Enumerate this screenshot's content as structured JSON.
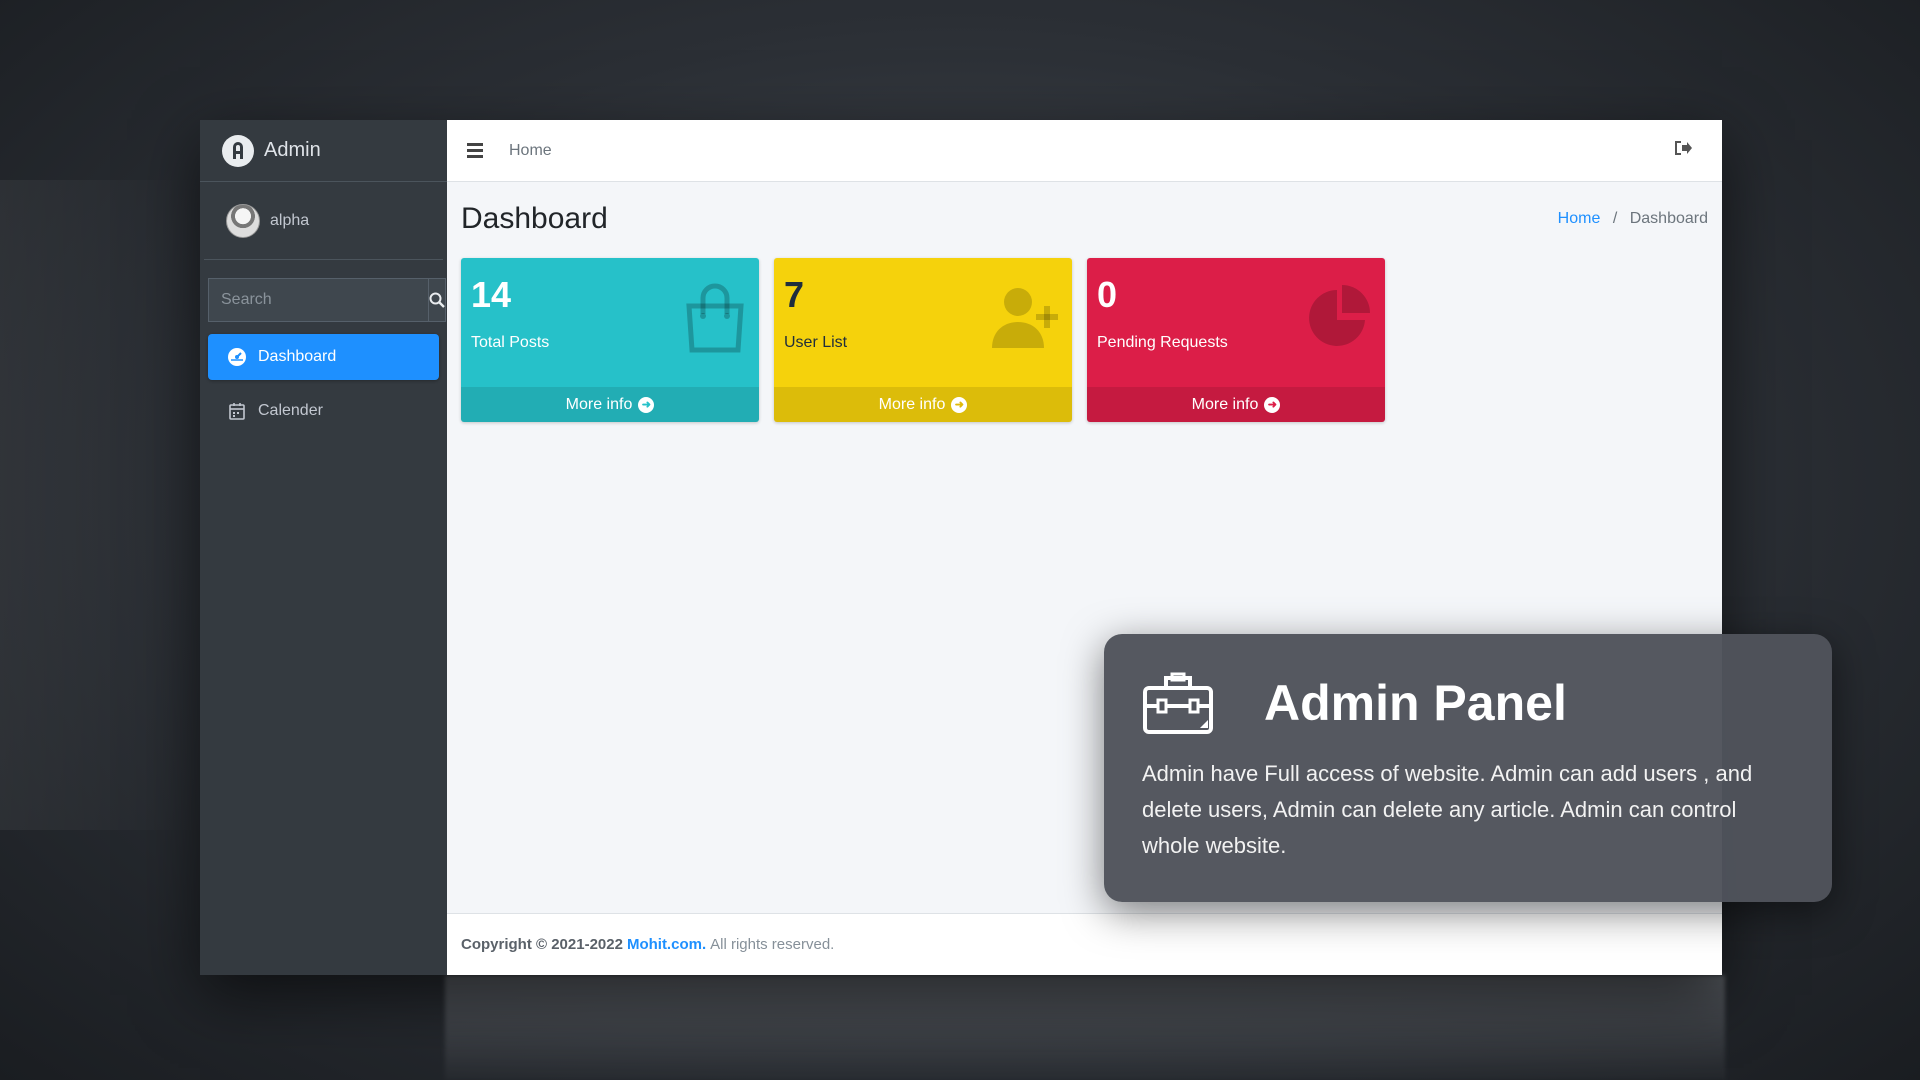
{
  "brand": {
    "name": "Admin"
  },
  "user": {
    "name": "alpha"
  },
  "search": {
    "placeholder": "Search"
  },
  "sidebar": {
    "items": [
      {
        "label": "Dashboard",
        "icon": "dashboard-icon",
        "active": true
      },
      {
        "label": "Calender",
        "icon": "calendar-icon",
        "active": false
      }
    ]
  },
  "topbar": {
    "home_link": "Home"
  },
  "page": {
    "title": "Dashboard"
  },
  "breadcrumb": {
    "home": "Home",
    "separator": "/",
    "current": "Dashboard"
  },
  "boxes": [
    {
      "value": "14",
      "label": "Total Posts",
      "footer": "More info",
      "icon": "shopping-bag-icon",
      "color": "#26c1c9"
    },
    {
      "value": "7",
      "label": "User List",
      "footer": "More info",
      "icon": "user-plus-icon",
      "color": "#f5d20c"
    },
    {
      "value": "0",
      "label": "Pending Requests",
      "footer": "More info",
      "icon": "pie-chart-icon",
      "color": "#dc1e48"
    }
  ],
  "footer": {
    "copyright": "Copyright © 2021-2022",
    "site": "Mohit.com.",
    "rights": "All rights reserved."
  },
  "overlay": {
    "title": "Admin Panel",
    "text": "Admin have Full access of website. Admin can add users , and delete users, Admin can delete any article. Admin can control whole website.",
    "icon": "toolbox-icon"
  }
}
